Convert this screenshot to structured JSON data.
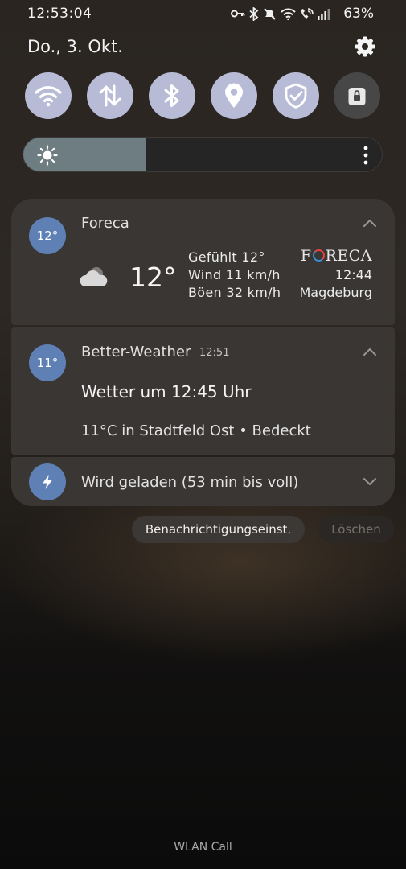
{
  "status_bar": {
    "time": "12:53:04",
    "battery": "63%",
    "icons": [
      "key-icon",
      "bluetooth-icon",
      "mute-icon",
      "wifi-icon",
      "wifi-call-icon",
      "signal-icon"
    ]
  },
  "header": {
    "date": "Do., 3. Okt."
  },
  "quick_settings": [
    {
      "name": "wifi",
      "active": true
    },
    {
      "name": "mobile-data",
      "active": true
    },
    {
      "name": "bluetooth",
      "active": true
    },
    {
      "name": "location",
      "active": true
    },
    {
      "name": "secure-wifi",
      "active": true
    },
    {
      "name": "secure-folder",
      "active": false
    }
  ],
  "brightness": {
    "level": 0.34
  },
  "notifications": {
    "foreca": {
      "badge": "12°",
      "app": "Foreca",
      "temperature": "12°",
      "felt": "Gefühlt 12°",
      "wind": "Wind 11 km/h",
      "gusts": "Böen 32 km/h",
      "logo_left": "F",
      "logo_right": "RECA",
      "time": "12:44",
      "city": "Magdeburg"
    },
    "better_weather": {
      "badge": "11°",
      "app": "Better-Weather",
      "time": "12:51",
      "title": "Wetter um 12:45 Uhr",
      "subtitle": "11°C in Stadtfeld Ost • Bedeckt"
    },
    "charging": {
      "text": "Wird geladen (53 min bis voll)"
    }
  },
  "actions": {
    "settings_label": "Benachrichtigungseinst.",
    "clear_label": "Löschen"
  },
  "footer": {
    "carrier": "WLAN Call"
  },
  "colors": {
    "toggle_active": "#b7bbd6",
    "toggle_inactive": "#474747",
    "badge_blue": "#5f80b5",
    "card": "#393634"
  }
}
